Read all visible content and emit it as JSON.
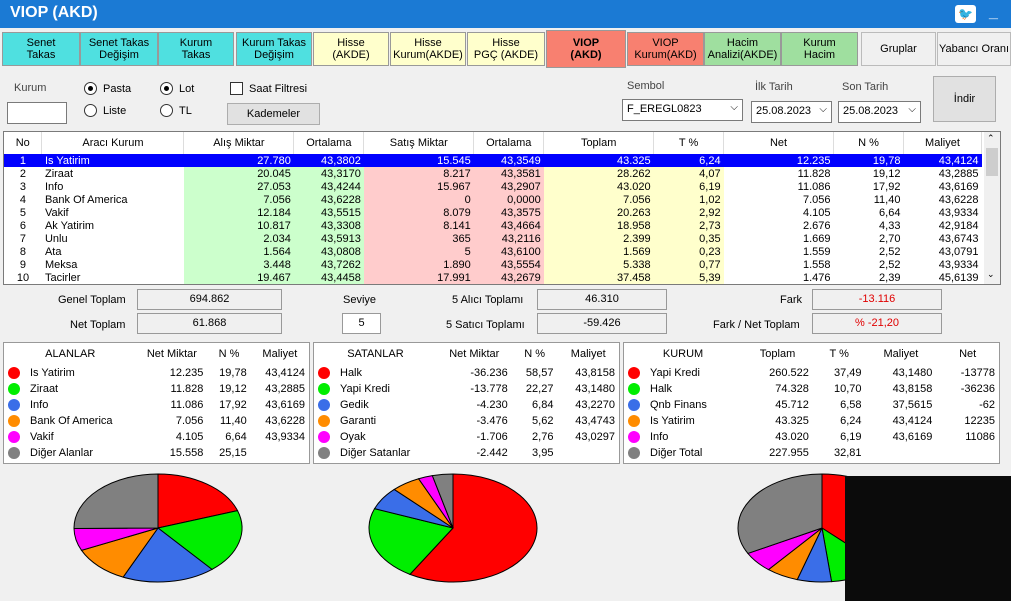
{
  "title": "VIOP (AKD)",
  "tabs": [
    {
      "label": "Senet\nTakas",
      "style": "cyan"
    },
    {
      "label": "Senet Takas\nDeğişim",
      "style": "cyan"
    },
    {
      "label": "Kurum\nTakas",
      "style": "cyan"
    },
    {
      "label": "Kurum Takas\nDeğişim",
      "style": "cyan"
    },
    {
      "label": "Hisse\n(AKDE)",
      "style": "yellow"
    },
    {
      "label": "Hisse\nKurum(AKDE)",
      "style": "yellow"
    },
    {
      "label": "Hisse\nPGÇ (AKDE)",
      "style": "yellow"
    },
    {
      "label": "VIOP\n(AKD)",
      "style": "salmon",
      "active": true
    },
    {
      "label": "VIOP\nKurum(AKD)",
      "style": "salmon"
    },
    {
      "label": "Hacim\nAnalizi(AKDE)",
      "style": "green"
    },
    {
      "label": "Kurum\nHacim",
      "style": "green"
    },
    {
      "label": "Gruplar",
      "style": "plain"
    },
    {
      "label": "Yabancı Oranı",
      "style": "plain"
    }
  ],
  "filters": {
    "kurum_label": "Kurum",
    "kurum_value": "",
    "pasta": "Pasta",
    "liste": "Liste",
    "lot": "Lot",
    "tl": "TL",
    "saat_filtresi": "Saat Filtresi",
    "kademeler": "Kademeler",
    "sembol_label": "Sembol",
    "sembol_value": "F_EREGL0823",
    "ilk_tarih_label": "İlk Tarih",
    "ilk_tarih_value": "25.08.2023",
    "son_tarih_label": "Son Tarih",
    "son_tarih_value": "25.08.2023",
    "indir": "İndir"
  },
  "main_table": {
    "headers": [
      "No",
      "Aracı Kurum",
      "Alış Miktar",
      "Ortalama",
      "Satış Miktar",
      "Ortalama",
      "Toplam",
      "T %",
      "Net",
      "N %",
      "Maliyet"
    ],
    "rows": [
      [
        "1",
        "Is Yatirim",
        "27.780",
        "43,3802",
        "15.545",
        "43,3549",
        "43.325",
        "6,24",
        "12.235",
        "19,78",
        "43,4124"
      ],
      [
        "2",
        "Ziraat",
        "20.045",
        "43,3170",
        "8.217",
        "43,3581",
        "28.262",
        "4,07",
        "11.828",
        "19,12",
        "43,2885"
      ],
      [
        "3",
        "Info",
        "27.053",
        "43,4244",
        "15.967",
        "43,2907",
        "43.020",
        "6,19",
        "11.086",
        "17,92",
        "43,6169"
      ],
      [
        "4",
        "Bank Of America",
        "7.056",
        "43,6228",
        "0",
        "0,0000",
        "7.056",
        "1,02",
        "7.056",
        "11,40",
        "43,6228"
      ],
      [
        "5",
        "Vakif",
        "12.184",
        "43,5515",
        "8.079",
        "43,3575",
        "20.263",
        "2,92",
        "4.105",
        "6,64",
        "43,9334"
      ],
      [
        "6",
        "Ak Yatirim",
        "10.817",
        "43,3308",
        "8.141",
        "43,4664",
        "18.958",
        "2,73",
        "2.676",
        "4,33",
        "42,9184"
      ],
      [
        "7",
        "Unlu",
        "2.034",
        "43,5913",
        "365",
        "43,2116",
        "2.399",
        "0,35",
        "1.669",
        "2,70",
        "43,6743"
      ],
      [
        "8",
        "Ata",
        "1.564",
        "43,0808",
        "5",
        "43,6100",
        "1.569",
        "0,23",
        "1.559",
        "2,52",
        "43,0791"
      ],
      [
        "9",
        "Meksa",
        "3.448",
        "43,7262",
        "1.890",
        "43,5554",
        "5.338",
        "0,77",
        "1.558",
        "2,52",
        "43,9334"
      ],
      [
        "10",
        "Tacirler",
        "19.467",
        "43,4458",
        "17.991",
        "43,2679",
        "37.458",
        "5,39",
        "1.476",
        "2,39",
        "45,6139"
      ]
    ]
  },
  "summary": {
    "genel_toplam_label": "Genel Toplam",
    "genel_toplam": "694.862",
    "net_toplam_label": "Net Toplam",
    "net_toplam": "61.868",
    "seviye_label": "Seviye",
    "seviye": "5",
    "alici_label": "5  Alıcı Toplamı",
    "alici": "46.310",
    "satici_label": "5  Satıcı Toplamı",
    "satici": "-59.426",
    "fark_label": "Fark",
    "fark": "-13.116",
    "fark_net_label": "Fark / Net Toplam",
    "fark_net": "% -21,20"
  },
  "alanlar": {
    "headers": [
      "ALANLAR",
      "Net Miktar",
      "N %",
      "Maliyet"
    ],
    "rows": [
      {
        "color": "#ff0000",
        "name": "Is Yatirim",
        "v1": "12.235",
        "v2": "19,78",
        "v3": "43,4124"
      },
      {
        "color": "#00ee00",
        "name": "Ziraat",
        "v1": "11.828",
        "v2": "19,12",
        "v3": "43,2885"
      },
      {
        "color": "#3a6ee8",
        "name": "Info",
        "v1": "11.086",
        "v2": "17,92",
        "v3": "43,6169"
      },
      {
        "color": "#ff8c00",
        "name": "Bank Of America",
        "v1": "7.056",
        "v2": "11,40",
        "v3": "43,6228"
      },
      {
        "color": "#ff00ff",
        "name": "Vakif",
        "v1": "4.105",
        "v2": "6,64",
        "v3": "43,9334"
      },
      {
        "color": "#808080",
        "name": "Diğer Alanlar",
        "v1": "15.558",
        "v2": "25,15",
        "v3": ""
      }
    ]
  },
  "satanlar": {
    "headers": [
      "SATANLAR",
      "Net Miktar",
      "N %",
      "Maliyet"
    ],
    "rows": [
      {
        "color": "#ff0000",
        "name": "Halk",
        "v1": "-36.236",
        "v2": "58,57",
        "v3": "43,8158"
      },
      {
        "color": "#00ee00",
        "name": "Yapi Kredi",
        "v1": "-13.778",
        "v2": "22,27",
        "v3": "43,1480"
      },
      {
        "color": "#3a6ee8",
        "name": "Gedik",
        "v1": "-4.230",
        "v2": "6,84",
        "v3": "43,2270"
      },
      {
        "color": "#ff8c00",
        "name": "Garanti",
        "v1": "-3.476",
        "v2": "5,62",
        "v3": "43,4743"
      },
      {
        "color": "#ff00ff",
        "name": "Oyak",
        "v1": "-1.706",
        "v2": "2,76",
        "v3": "43,0297"
      },
      {
        "color": "#808080",
        "name": "Diğer Satanlar",
        "v1": "-2.442",
        "v2": "3,95",
        "v3": ""
      }
    ]
  },
  "kurum": {
    "headers": [
      "KURUM",
      "Toplam",
      "T %",
      "Maliyet",
      "Net"
    ],
    "rows": [
      {
        "color": "#ff0000",
        "name": "Yapi Kredi",
        "v1": "260.522",
        "v2": "37,49",
        "v3": "43,1480",
        "v4": "-13778"
      },
      {
        "color": "#00ee00",
        "name": "Halk",
        "v1": "74.328",
        "v2": "10,70",
        "v3": "43,8158",
        "v4": "-36236"
      },
      {
        "color": "#3a6ee8",
        "name": "Qnb Finans",
        "v1": "45.712",
        "v2": "6,58",
        "v3": "37,5615",
        "v4": "-62"
      },
      {
        "color": "#ff8c00",
        "name": "Is Yatirim",
        "v1": "43.325",
        "v2": "6,24",
        "v3": "43,4124",
        "v4": "12235"
      },
      {
        "color": "#ff00ff",
        "name": "Info",
        "v1": "43.020",
        "v2": "6,19",
        "v3": "43,6169",
        "v4": "11086"
      },
      {
        "color": "#808080",
        "name": "Diğer Total",
        "v1": "227.955",
        "v2": "32,81",
        "v3": "",
        "v4": ""
      }
    ]
  },
  "pies": [
    {
      "values": [
        19.78,
        19.12,
        17.92,
        11.4,
        6.64,
        25.15
      ],
      "colors": [
        "#ff0000",
        "#00ee00",
        "#3a6ee8",
        "#ff8c00",
        "#ff00ff",
        "#808080"
      ]
    },
    {
      "values": [
        58.57,
        22.27,
        6.84,
        5.62,
        2.76,
        3.95
      ],
      "colors": [
        "#ff0000",
        "#00ee00",
        "#3a6ee8",
        "#ff8c00",
        "#ff00ff",
        "#808080"
      ]
    },
    {
      "values": [
        37.49,
        10.7,
        6.58,
        6.24,
        6.19,
        32.81
      ],
      "colors": [
        "#ff0000",
        "#00ee00",
        "#3a6ee8",
        "#ff8c00",
        "#ff00ff",
        "#808080"
      ]
    }
  ],
  "colors": {
    "title_bar": "#1b7ad4",
    "selected_row": "#0000ff",
    "buy_col": "#ccffcc",
    "sell_col": "#ffcccc",
    "total_col": "#ffffcc",
    "negative": "#e00000"
  }
}
